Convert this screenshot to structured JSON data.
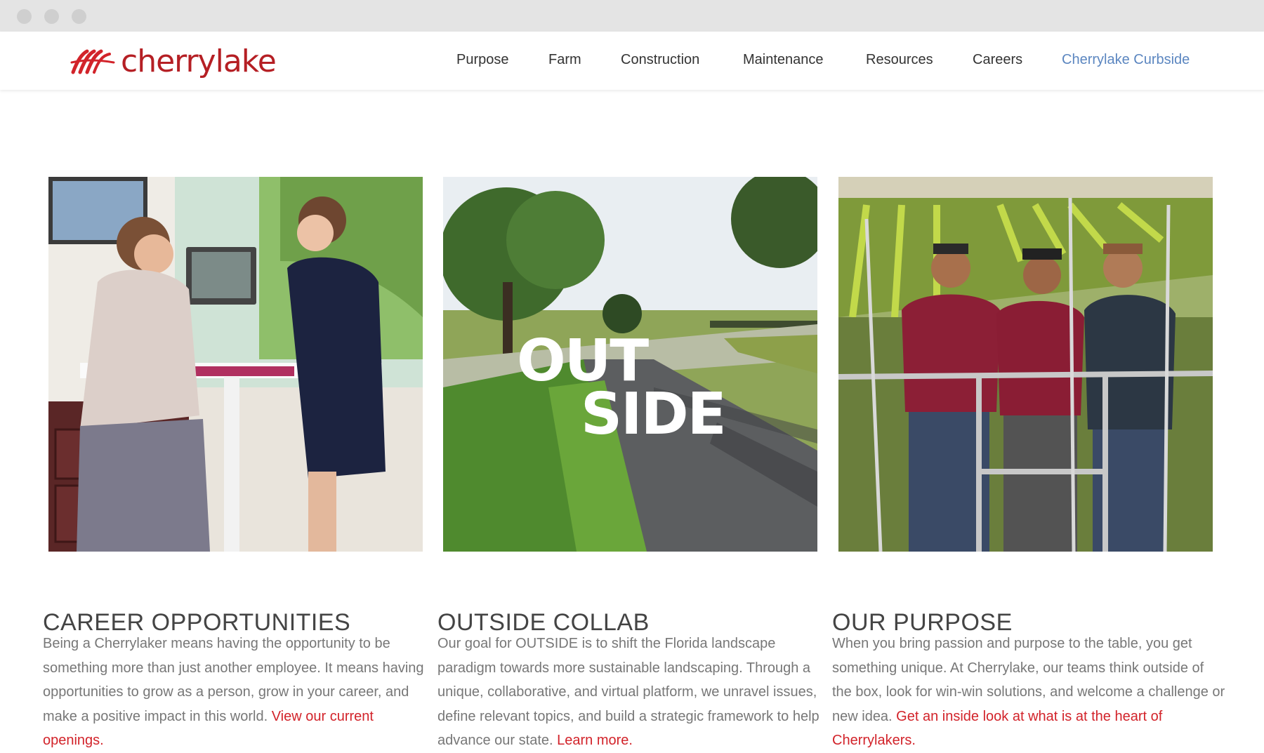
{
  "window": {
    "controls": [
      "close",
      "minimize",
      "maximize"
    ]
  },
  "brand": {
    "name": "cherrylake",
    "color": "#b51f24",
    "icon": "cherrylake-swoosh-logo"
  },
  "nav": {
    "items": [
      "Purpose",
      "Farm",
      "Construction",
      "Maintenance",
      "Resources",
      "Careers",
      "Cherrylake Curbside"
    ],
    "accent_item": "Cherrylake Curbside",
    "accent_color": "#5b86c0"
  },
  "cards": [
    {
      "image": "office-two-women-reviewing-documents-photo",
      "title": "CAREER OPPORTUNITIES",
      "body": "Being a Cherrylaker means having the opportunity to be something more than just another employee. It means having opportunities to grow as a person, grow in your career, and make a positive impact in this world. ",
      "link": "View our current openings."
    },
    {
      "image": "outside-road-landscape-photo",
      "image_text": [
        "OUT",
        "SIDE"
      ],
      "title": "OUTSIDE COLLAB",
      "body": "Our goal for OUTSIDE is to shift the Florida landscape paradigm towards more sustainable landscaping. Through a unique, collaborative, and virtual platform, we unravel issues, define relevant topics, and build a strategic framework to help advance our state. ",
      "link": "Learn more."
    },
    {
      "image": "three-farm-workers-photo",
      "title": "OUR PURPOSE",
      "body": "When you bring passion and purpose to the table, you get something unique. At Cherrylake, our teams think outside of the box, look for win-win solutions, and welcome a challenge or new idea. ",
      "link": "Get an inside look at what is at the heart of Cherrylakers."
    }
  ],
  "link_color": "#d2232a"
}
